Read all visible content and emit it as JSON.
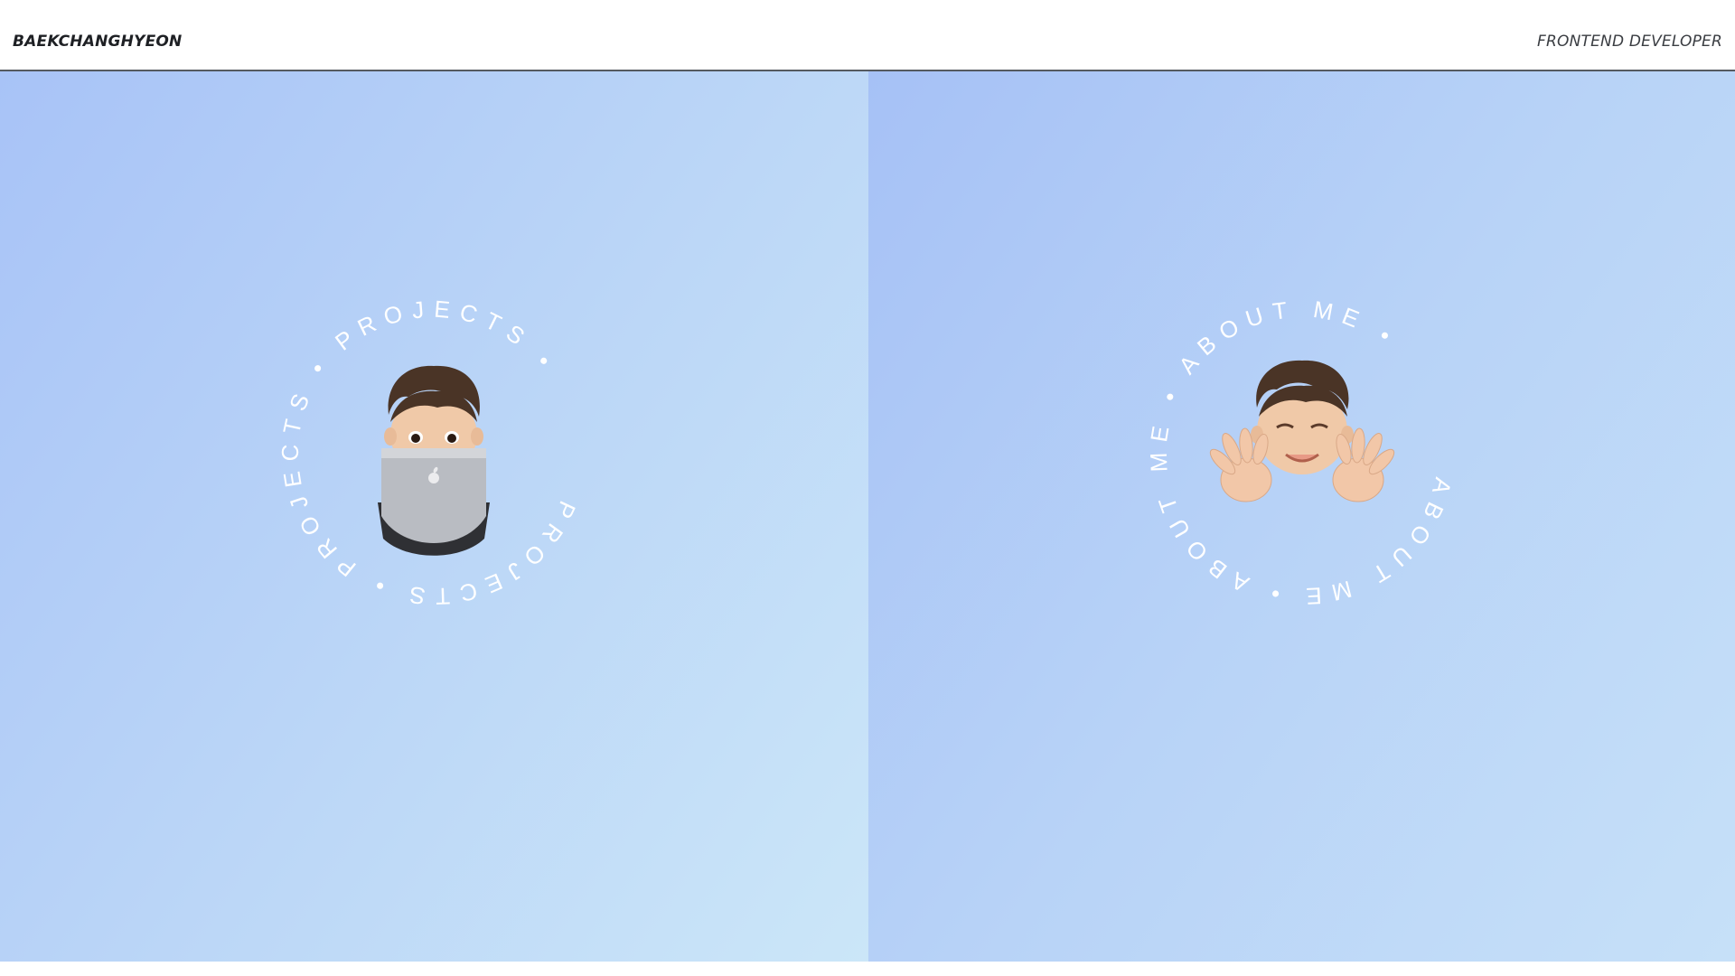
{
  "header": {
    "brand": "BAEKCHANGHYEON",
    "role": "FRONTEND DEVELOPER"
  },
  "panels": [
    {
      "ring_text": "PROJECTS • PROJECTS • PROJECTS • ",
      "avatar_icon": "memoji-with-laptop-icon"
    },
    {
      "ring_text": "ABOUT ME • ABOUT ME • ABOUT ME • ",
      "avatar_icon": "memoji-waving-hands-icon"
    }
  ],
  "colors": {
    "gradient_start": "#a8c3f7",
    "gradient_end": "#cbe6f8",
    "ring_text": "#ffffff"
  }
}
